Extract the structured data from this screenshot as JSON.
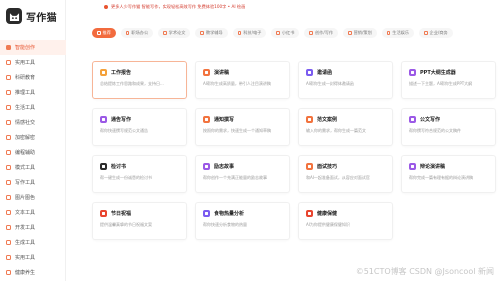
{
  "app": {
    "name": "写作猫"
  },
  "sidebar": {
    "items": [
      {
        "label": "智能创作",
        "active": true
      },
      {
        "label": "实用工具"
      },
      {
        "label": "科研教育"
      },
      {
        "label": "推理工具"
      },
      {
        "label": "生活工具"
      },
      {
        "label": "情感社交"
      },
      {
        "label": "加密解密"
      },
      {
        "label": "编程辅助"
      },
      {
        "label": "模式工具"
      },
      {
        "label": "写作工具"
      },
      {
        "label": "图片图色"
      },
      {
        "label": "文本工具"
      },
      {
        "label": "开发工具"
      },
      {
        "label": "生成工具"
      },
      {
        "label": "实用工具"
      },
      {
        "label": "健康养生"
      }
    ]
  },
  "banner": {
    "text": "更多人少写作猫 智能写作，实现轻松高效写作 免费体验100字 • AI 绘画"
  },
  "tabs": [
    {
      "label": "推荐",
      "active": true
    },
    {
      "label": "职场办公"
    },
    {
      "label": "学术论文"
    },
    {
      "label": "教学辅导"
    },
    {
      "label": "科技/电子"
    },
    {
      "label": "小红书"
    },
    {
      "label": "创作/写作"
    },
    {
      "label": "营销/策划"
    },
    {
      "label": "生活娱乐"
    },
    {
      "label": "企业/商务"
    }
  ],
  "cards": [
    {
      "title": "工作报告",
      "desc": "总结提炼工作思路和成果，支持日...",
      "color": "#f4a13a",
      "active": true
    },
    {
      "title": "演讲稿",
      "desc": "AI帮你生成高质量，带引人注目演讲稿",
      "color": "#f2733e"
    },
    {
      "title": "邀请函",
      "desc": "AI帮你生成一封得体邀请函",
      "color": "#7b5cf0"
    },
    {
      "title": "PPT大纲生成器",
      "desc": "描述一下主题，AI帮你生成PPT大纲",
      "color": "#9b59e6"
    },
    {
      "title": "通告写作",
      "desc": "帮你快速撰写规范公文通告",
      "color": "#9b59e6"
    },
    {
      "title": "通知撰写",
      "desc": "按照你的需求，快速生成一个通知草稿",
      "color": "#f2733e"
    },
    {
      "title": "范文案例",
      "desc": "输入你的需求，帮你生成一篇范文",
      "color": "#f2733e"
    },
    {
      "title": "公文写作",
      "desc": "帮你撰写符合规范的公文稿件",
      "color": "#9b59e6"
    },
    {
      "title": "检讨书",
      "desc": "帮一键生成一份诚恳的检讨书",
      "color": "#2b2b2b"
    },
    {
      "title": "励志故事",
      "desc": "帮你创作一个充满正能量的励志故事",
      "color": "#9b59e6"
    },
    {
      "title": "面试技巧",
      "desc": "和AI一起准备面试，从容应对面试官",
      "color": "#f2733e"
    },
    {
      "title": "辩论演讲稿",
      "desc": "帮你完成一篇有理有据的辩论演讲稿",
      "color": "#9b59e6"
    },
    {
      "title": "节日祝福",
      "desc": "提供温馨真挚的节日祝福文案",
      "color": "#e8452f"
    },
    {
      "title": "食物热量分析",
      "desc": "帮你快速分析食物的热量",
      "color": "#7b5cf0"
    },
    {
      "title": "健康保健",
      "desc": "AI为你提供健康保健知识",
      "color": "#e8452f"
    }
  ],
  "watermark": "©51CTO博客 CSDN @Jsoncool 新闻"
}
